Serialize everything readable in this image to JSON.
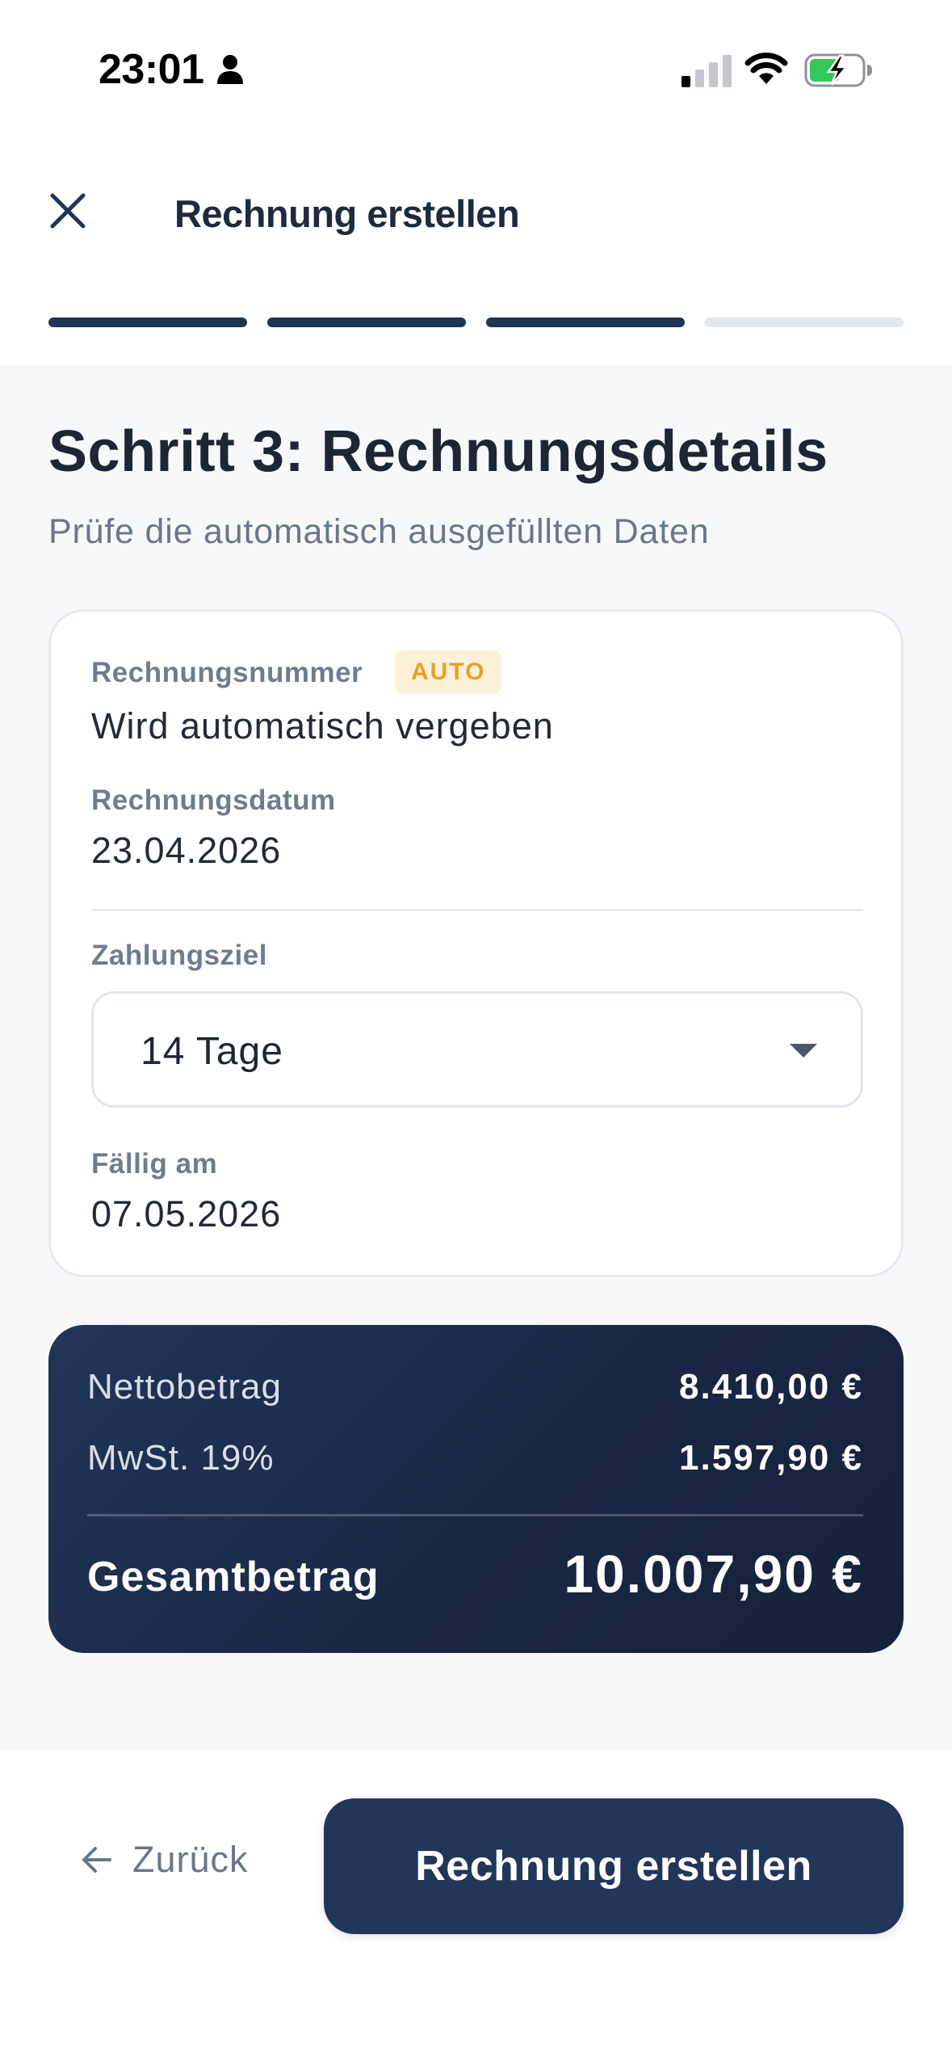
{
  "status_bar": {
    "time": "23:01"
  },
  "header": {
    "title": "Rechnung erstellen",
    "progress": {
      "total_steps": 4,
      "completed_steps": 3
    }
  },
  "step": {
    "title": "Schritt 3: Rechnungsdetails",
    "subtitle": "Prüfe die automatisch ausgefüllten Daten"
  },
  "details": {
    "invoice_number": {
      "label": "Rechnungsnummer",
      "badge": "AUTO",
      "value": "Wird automatisch vergeben"
    },
    "invoice_date": {
      "label": "Rechnungsdatum",
      "value": "23.04.2026"
    },
    "payment_terms": {
      "label": "Zahlungsziel",
      "selected": "14 Tage"
    },
    "due_date": {
      "label": "Fällig am",
      "value": "07.05.2026"
    }
  },
  "summary": {
    "net": {
      "label": "Nettobetrag",
      "value": "8.410,00 €"
    },
    "vat": {
      "label": "MwSt. 19%",
      "value": "1.597,90 €"
    },
    "total": {
      "label": "Gesamtbetrag",
      "value": "10.007,90 €"
    }
  },
  "footer": {
    "back_label": "Zurück",
    "submit_label": "Rechnung erstellen"
  },
  "colors": {
    "primary": "#213659",
    "badge_bg": "#fdf0d9",
    "badge_text": "#e8a02a",
    "battery_green": "#34c759"
  },
  "icons": [
    "person-icon",
    "signal-icon",
    "wifi-icon",
    "battery-charging-icon",
    "close-icon",
    "chevron-down-icon",
    "arrow-left-icon"
  ]
}
